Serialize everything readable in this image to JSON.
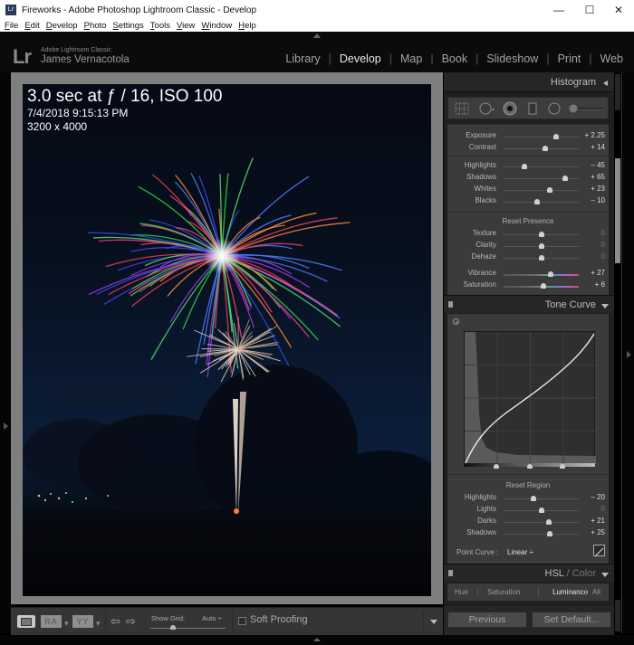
{
  "window": {
    "title": "Fireworks - Adobe Photoshop Lightroom Classic - Develop",
    "app_icon": "Lr",
    "controls": {
      "minimize": "—",
      "maximize": "☐",
      "close": "✕"
    }
  },
  "menubar": [
    {
      "label": "File",
      "mnemonic": "F",
      "rest": "ile"
    },
    {
      "label": "Edit",
      "mnemonic": "E",
      "rest": "dit"
    },
    {
      "label": "Develop",
      "mnemonic": "D",
      "rest": "evelop"
    },
    {
      "label": "Photo",
      "mnemonic": "P",
      "rest": "hoto"
    },
    {
      "label": "Settings",
      "mnemonic": "S",
      "rest": "ettings"
    },
    {
      "label": "Tools",
      "mnemonic": "T",
      "rest": "ools"
    },
    {
      "label": "View",
      "mnemonic": "V",
      "rest": "iew"
    },
    {
      "label": "Window",
      "mnemonic": "W",
      "rest": "indow"
    },
    {
      "label": "Help",
      "mnemonic": "H",
      "rest": "elp"
    }
  ],
  "identity": {
    "logo": "Lr",
    "product": "Adobe Lightroom Classic",
    "user": "James Vernacotola"
  },
  "modules": [
    {
      "label": "Library",
      "active": false
    },
    {
      "label": "Develop",
      "active": true
    },
    {
      "label": "Map",
      "active": false
    },
    {
      "label": "Book",
      "active": false
    },
    {
      "label": "Slideshow",
      "active": false
    },
    {
      "label": "Print",
      "active": false
    },
    {
      "label": "Web",
      "active": false
    }
  ],
  "photo_info": {
    "exposure": "3.0 sec at ƒ / 16, ISO 100",
    "datetime": "7/4/2018 9:15:13 PM",
    "dimensions": "3200 x 4000"
  },
  "toolbar": {
    "view_compare_ra": "RA",
    "view_compare_yy": "YY",
    "show_grid_label": "Show Grid:",
    "show_grid_value": "Auto ÷",
    "show_grid_slider": 0.3,
    "soft_proofing_label": "Soft Proofing",
    "soft_proofing_checked": false
  },
  "panel": {
    "histogram_title": "Histogram",
    "tools": [
      "crop-overlay",
      "spot-removal",
      "red-eye",
      "graduated-filter",
      "radial-filter",
      "adjustment-brush"
    ],
    "basic": {
      "tone": [
        {
          "label": "Exposure",
          "value": "+ 2.25",
          "pos": 0.7
        },
        {
          "label": "Contrast",
          "value": "+ 14",
          "pos": 0.56
        }
      ],
      "levels": [
        {
          "label": "Highlights",
          "value": "– 45",
          "pos": 0.28
        },
        {
          "label": "Shadows",
          "value": "+ 65",
          "pos": 0.82
        },
        {
          "label": "Whites",
          "value": "+ 23",
          "pos": 0.61
        },
        {
          "label": "Blacks",
          "value": "– 10",
          "pos": 0.45
        }
      ],
      "presence_reset": "Reset Presence",
      "presence": [
        {
          "label": "Texture",
          "value": "0",
          "pos": 0.5
        },
        {
          "label": "Clarity",
          "value": "0",
          "pos": 0.5
        },
        {
          "label": "Dehaze",
          "value": "0",
          "pos": 0.5
        }
      ],
      "color": [
        {
          "label": "Vibrance",
          "value": "+ 27",
          "pos": 0.63
        },
        {
          "label": "Saturation",
          "value": "+ 6",
          "pos": 0.53
        }
      ]
    },
    "tone_curve": {
      "title": "Tone Curve",
      "region_reset": "Reset Region",
      "region": [
        {
          "label": "Highlights",
          "value": "– 20",
          "pos": 0.4
        },
        {
          "label": "Lights",
          "value": "0",
          "pos": 0.5
        },
        {
          "label": "Darks",
          "value": "+ 21",
          "pos": 0.6
        },
        {
          "label": "Shadows",
          "value": "+ 25",
          "pos": 0.62
        }
      ],
      "split_points": [
        0.25,
        0.5,
        0.75
      ],
      "point_curve_label": "Point Curve :",
      "point_curve_value": "Linear ÷"
    },
    "hsl": {
      "title_main": "HSL",
      "title_sep": " / ",
      "title_alt": "Color",
      "tabs": [
        {
          "label": "Hue",
          "active": false
        },
        {
          "label": "Saturation",
          "active": false
        },
        {
          "label": "Luminance",
          "active": true
        },
        {
          "label": "All",
          "active": false
        }
      ]
    },
    "buttons": {
      "previous": "Previous",
      "set_default": "Set Default..."
    }
  }
}
